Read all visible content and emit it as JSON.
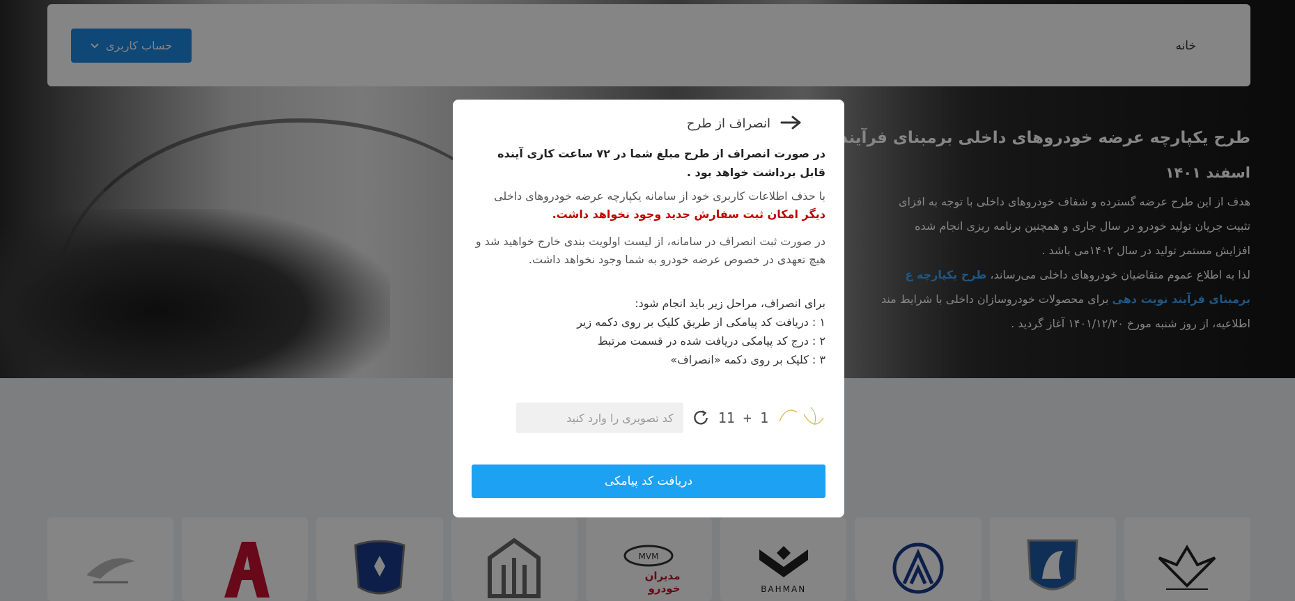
{
  "header": {
    "home_label": "خانه",
    "account_label": "حساب کاربری"
  },
  "hero": {
    "title": "طرح یکپارچه عرضه خودروهای داخلی برمبنای فرآیند نوبت",
    "date": "اسفند ۱۴۰۱",
    "line1": "هدف از این طرح عرضه گسترده و شفاف خودروهای داخلی با توجه به افزای",
    "line2": "تثبیت جریان تولید خودرو در سال جاری و همچنین برنامه ریزی انجام شده",
    "line3": "افزایش مستمر تولید در سال ۱۴۰۲می باشد .",
    "line4_text": "لذا به اطلاع عموم متقاضیان خودروهای داخلی می‌رساند،",
    "line4_link": "طرح یکپارچه ع",
    "line5_link": "برمبنای فرآیند نوبت دهی",
    "line5_text": "برای محصولات خودروسازان داخلی با شرایط مند",
    "line6": "اطلاعیه، از روز شنبه مورخ ۱۴۰۱/۱۲/۲۰ آغاز گردید ."
  },
  "modal": {
    "title": "انصراف از طرح",
    "bold_text": "در صورت انصراف از طرح مبلغ شما در ۷۲ ساعت کاری آینده قابل برداشت خواهد بود .",
    "p1_text": "با حذف اطلاعات کاربری خود از سامانه یکپارچه عرضه خودروهای داخلی",
    "p1_red": "دیگر امکان ثبت سفارش جدید وجود نخواهد داشت.",
    "p2_text": "در صورت ثبت انصراف در سامانه، از لیست اولویت بندی خارج خواهید شد و هیچ تعهدی در خصوص عرضه خودرو به شما وجود نخواهد داشت.",
    "steps_intro": "برای انصراف، مراحل زیر باید انجام شود:",
    "step1": "۱ : دریافت کد پیامکی از طریق کلیک بر روی دکمه زیر",
    "step2": "۲ : درج کد پیامکی دریافت شده در قسمت مرتبط",
    "step3": "۳ : کلیک بر روی دکمه «انصراف»",
    "captcha_expression": "11 + 1",
    "captcha_placeholder": "کد تصویری را وارد کنید",
    "submit_label": "دریافت کد پیامکی"
  },
  "brands": [
    {
      "name": "ketab-motors-logo"
    },
    {
      "name": "arya-logo",
      "color": "#c8102e"
    },
    {
      "name": "pars-khodro-logo",
      "color": "#1a3a8c"
    },
    {
      "name": "saipa-logo"
    },
    {
      "name": "modiran-khodro-logo",
      "label": "مدیران خودرو",
      "color": "#c8102e"
    },
    {
      "name": "bahman-logo",
      "label": "BAHMAN"
    },
    {
      "name": "arian-motor-logo",
      "color": "#1a3a8c"
    },
    {
      "name": "iran-khodro-logo",
      "color": "#1e5aa8"
    },
    {
      "name": "ilia-logo"
    }
  ]
}
